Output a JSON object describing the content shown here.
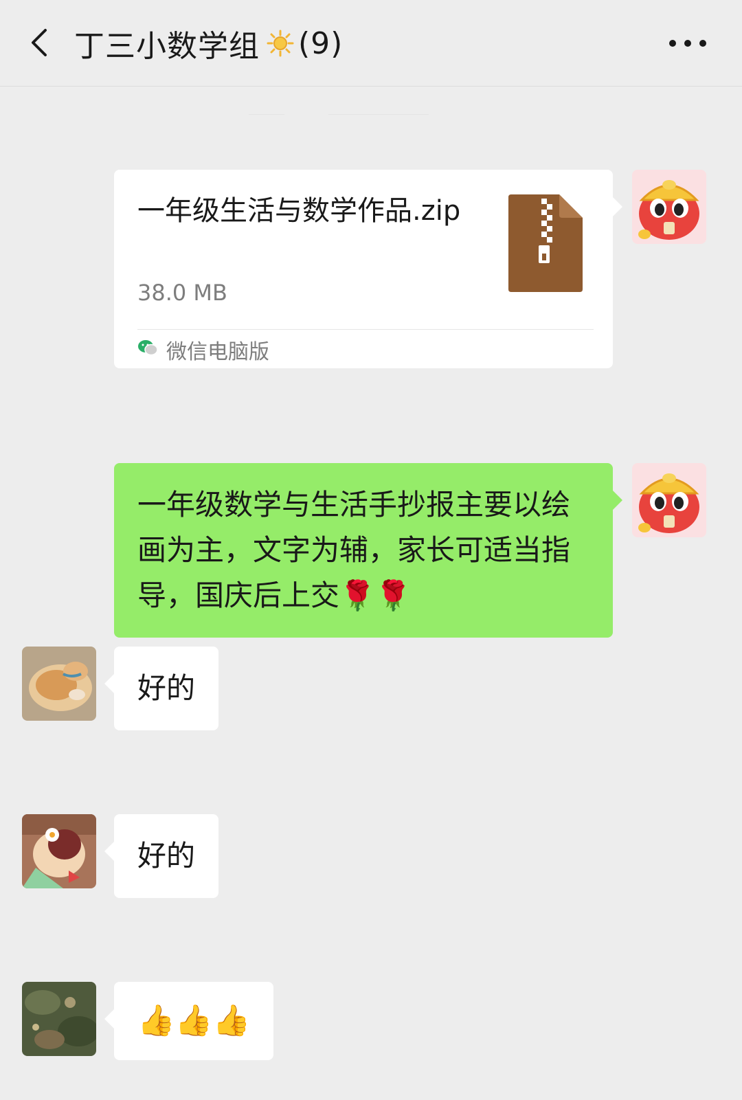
{
  "header": {
    "title": "丁三小数学组",
    "member_count": "(9)",
    "title_emoji": "sun-icon"
  },
  "messages": [
    {
      "type": "file",
      "side": "right",
      "file_name": "一年级生活与数学作品.zip",
      "file_size": "38.0 MB",
      "source": "微信电脑版",
      "file_icon": "zip-file-icon",
      "file_icon_color": "#8e5a2f"
    },
    {
      "type": "text",
      "side": "right",
      "text": "一年级数学与生活手抄报主要以绘画为主，文字为辅，家长可适当指导，国庆后上交🌹🌹"
    },
    {
      "type": "text",
      "side": "left",
      "text": "好的",
      "avatar": "cat-avatar"
    },
    {
      "type": "text",
      "side": "left",
      "text": "好的",
      "avatar": "cartoon-avatar"
    },
    {
      "type": "text",
      "side": "left",
      "text": "👍👍👍",
      "avatar": "nature-avatar"
    }
  ],
  "colors": {
    "background": "#ededed",
    "sent_bubble": "#95ec69",
    "received_bubble": "#ffffff",
    "secondary_text": "#7d7d7d"
  }
}
